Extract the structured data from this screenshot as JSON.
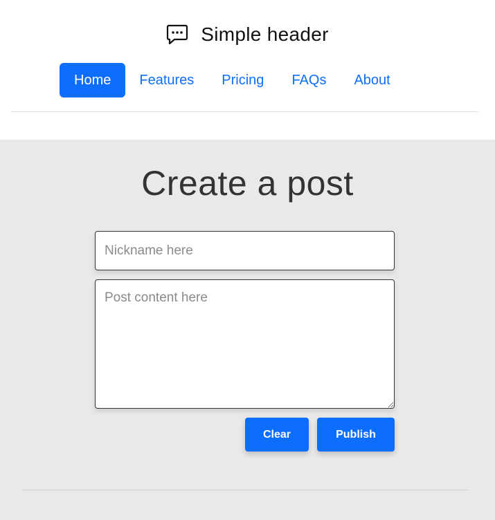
{
  "header": {
    "brand_icon": "chat-dots-icon",
    "title": "Simple header",
    "nav": [
      {
        "label": "Home",
        "active": true
      },
      {
        "label": "Features",
        "active": false
      },
      {
        "label": "Pricing",
        "active": false
      },
      {
        "label": "FAQs",
        "active": false
      },
      {
        "label": "About",
        "active": false
      }
    ]
  },
  "main": {
    "title": "Create a post",
    "nickname_placeholder": "Nickname here",
    "nickname_value": "",
    "content_placeholder": "Post content here",
    "content_value": "",
    "clear_label": "Clear",
    "publish_label": "Publish"
  },
  "colors": {
    "accent": "#0d6efd",
    "main_background": "#e9e9ea",
    "text": "#333333"
  }
}
